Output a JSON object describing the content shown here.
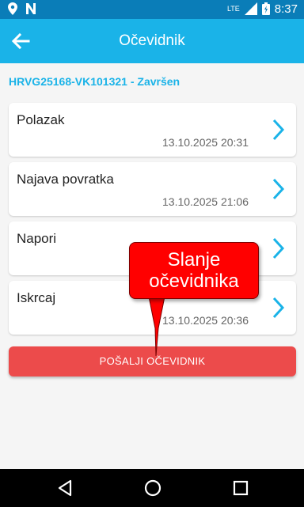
{
  "status_bar": {
    "network_label": "LTE",
    "time": "8:37",
    "icons": [
      "location-icon",
      "n-app-icon",
      "signal-icon",
      "battery-icon"
    ]
  },
  "app_bar": {
    "title": "Očevidnik",
    "back_icon": "arrow-left-icon"
  },
  "trip": {
    "header": "HRVG25168-VK101321 - Završen"
  },
  "sections": [
    {
      "title": "Polazak",
      "timestamp": "13.10.2025 20:31"
    },
    {
      "title": "Najava povratka",
      "timestamp": "13.10.2025 21:06"
    },
    {
      "title": "Napori",
      "timestamp": ""
    },
    {
      "title": "Iskrcaj",
      "timestamp": "13.10.2025 20:36"
    }
  ],
  "send_button": {
    "label": "POŠALJI OČEVIDNIK"
  },
  "callout": {
    "line1": "Slanje",
    "line2": "očevidnika"
  },
  "nav": {
    "icons": [
      "back-triangle-icon",
      "home-circle-icon",
      "recents-square-icon"
    ]
  },
  "colors": {
    "status_bar": "#0a7db8",
    "app_bar": "#1ab3e8",
    "accent": "#1ab3e8",
    "send_button": "#ec4b4b",
    "callout": "#ff0000",
    "background": "#f5f5f5"
  }
}
